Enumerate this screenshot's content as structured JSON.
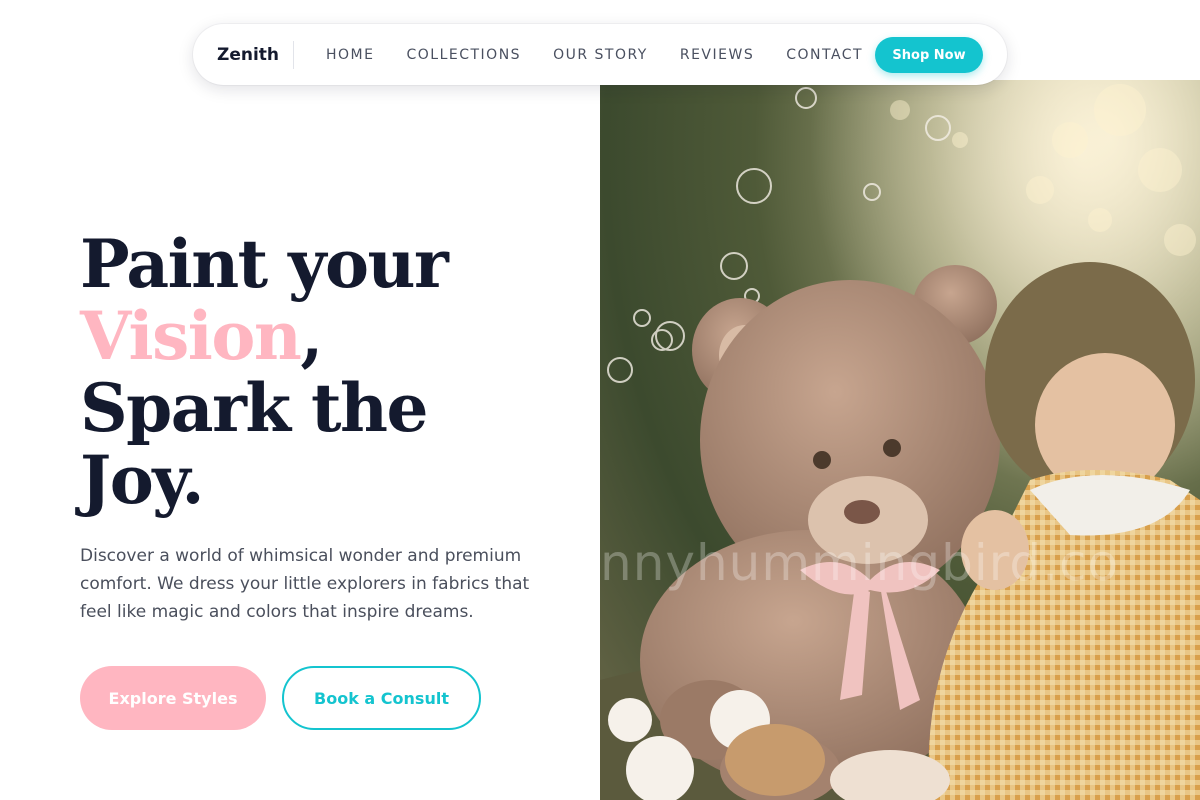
{
  "nav": {
    "brand": "Zenith",
    "links": [
      "HOME",
      "COLLECTIONS",
      "OUR STORY",
      "REVIEWS",
      "CONTACT"
    ],
    "cta": "Shop Now"
  },
  "hero": {
    "line1": "Paint your",
    "accent_word": "Vision",
    "comma": ",",
    "line3": "Spark the",
    "line4": "Joy.",
    "description": "Discover a world of whimsical wonder and premium comfort. We dress your little explorers in fabrics that feel like magic and colors that inspire dreams.",
    "primary_button": "Explore Styles",
    "secondary_button": "Book a Consult"
  },
  "image": {
    "watermark": "nnyhummingbird.co"
  },
  "colors": {
    "accent_pink": "#ffb6c1",
    "accent_teal": "#14c4cf",
    "heading": "#141a2e"
  }
}
